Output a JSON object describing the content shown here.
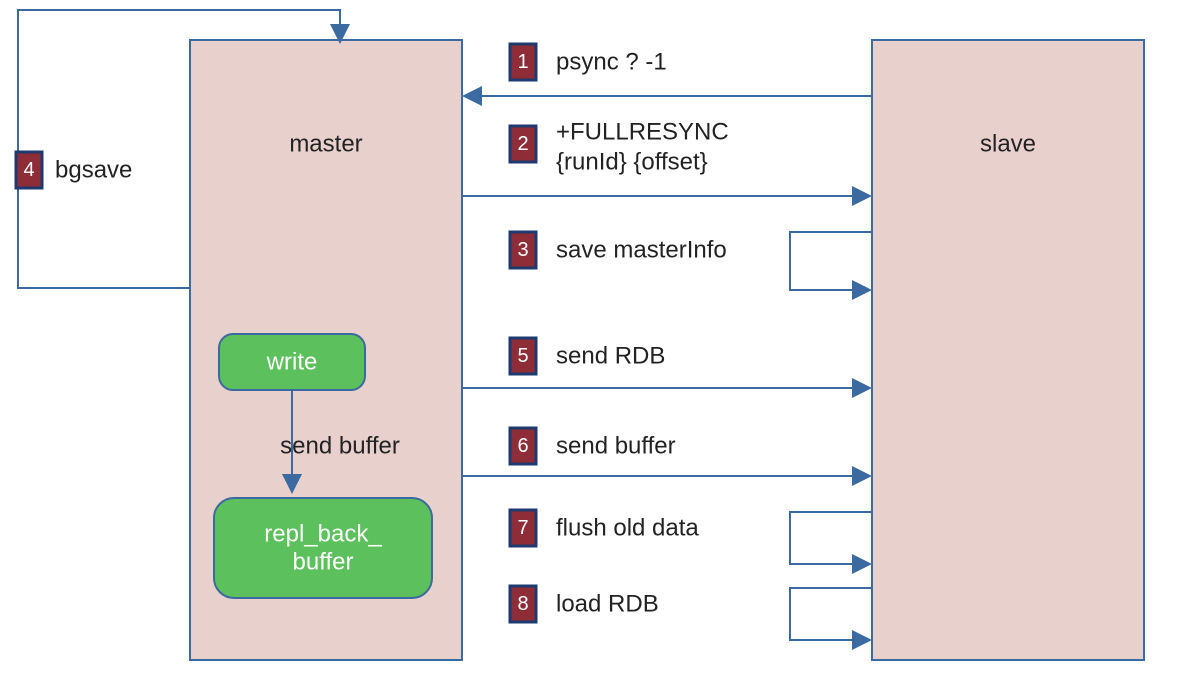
{
  "master": {
    "title": "master"
  },
  "slave": {
    "title": "slave"
  },
  "write_box": {
    "label": "write"
  },
  "buffer_box": {
    "label_line1": "repl_back_",
    "label_line2": "buffer"
  },
  "send_buffer_inner": "send buffer",
  "steps": {
    "s1": {
      "num": "1",
      "text": "psync ? -1"
    },
    "s2": {
      "num": "2",
      "text_line1": "+FULLRESYNC",
      "text_line2": "{runId} {offset}"
    },
    "s3": {
      "num": "3",
      "text": "save masterInfo"
    },
    "s4": {
      "num": "4",
      "text": "bgsave"
    },
    "s5": {
      "num": "5",
      "text": "send RDB"
    },
    "s6": {
      "num": "6",
      "text": "send buffer"
    },
    "s7": {
      "num": "7",
      "text": "flush old data"
    },
    "s8": {
      "num": "8",
      "text": "load RDB"
    }
  }
}
